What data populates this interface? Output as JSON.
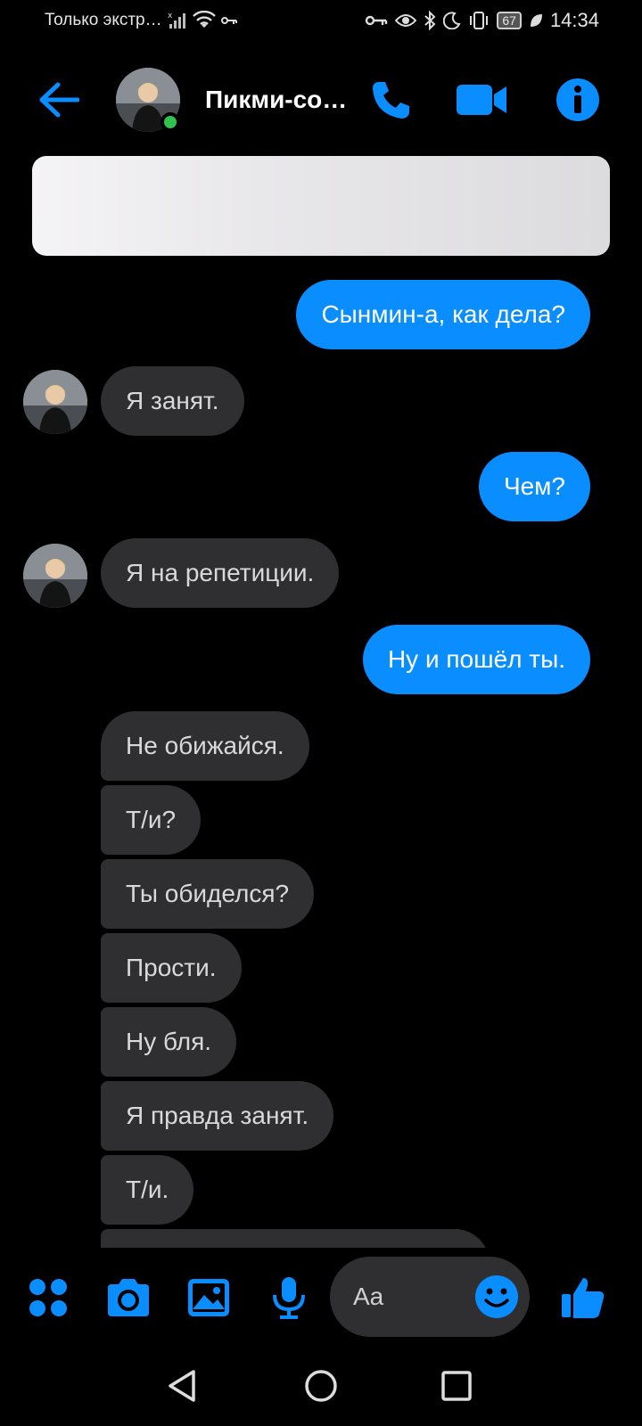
{
  "status_bar": {
    "left_text": "Только экстр…",
    "time": "14:34",
    "battery": "67"
  },
  "header": {
    "contact_name": "Пикми-сонбэ",
    "accent_color": "#0a8dff",
    "online_color": "#31c24d"
  },
  "messages": [
    {
      "side": "out",
      "text": "Сынмин-а, как дела?"
    },
    {
      "side": "in",
      "text": "Я занят."
    },
    {
      "side": "out",
      "text": "Чем?"
    },
    {
      "side": "in",
      "text": "Я на репетиции."
    },
    {
      "side": "out",
      "text": "Ну и пошёл ты."
    },
    {
      "side": "in",
      "text": "Не обижайся."
    },
    {
      "side": "in",
      "text": "Т/и?"
    },
    {
      "side": "in",
      "text": "Ты обиделся?"
    },
    {
      "side": "in",
      "text": "Прости."
    },
    {
      "side": "in",
      "text": "Ну бля."
    },
    {
      "side": "in",
      "text": "Я правда занят."
    },
    {
      "side": "in",
      "text": "Т/и."
    }
  ],
  "composer": {
    "placeholder": "Aa"
  }
}
